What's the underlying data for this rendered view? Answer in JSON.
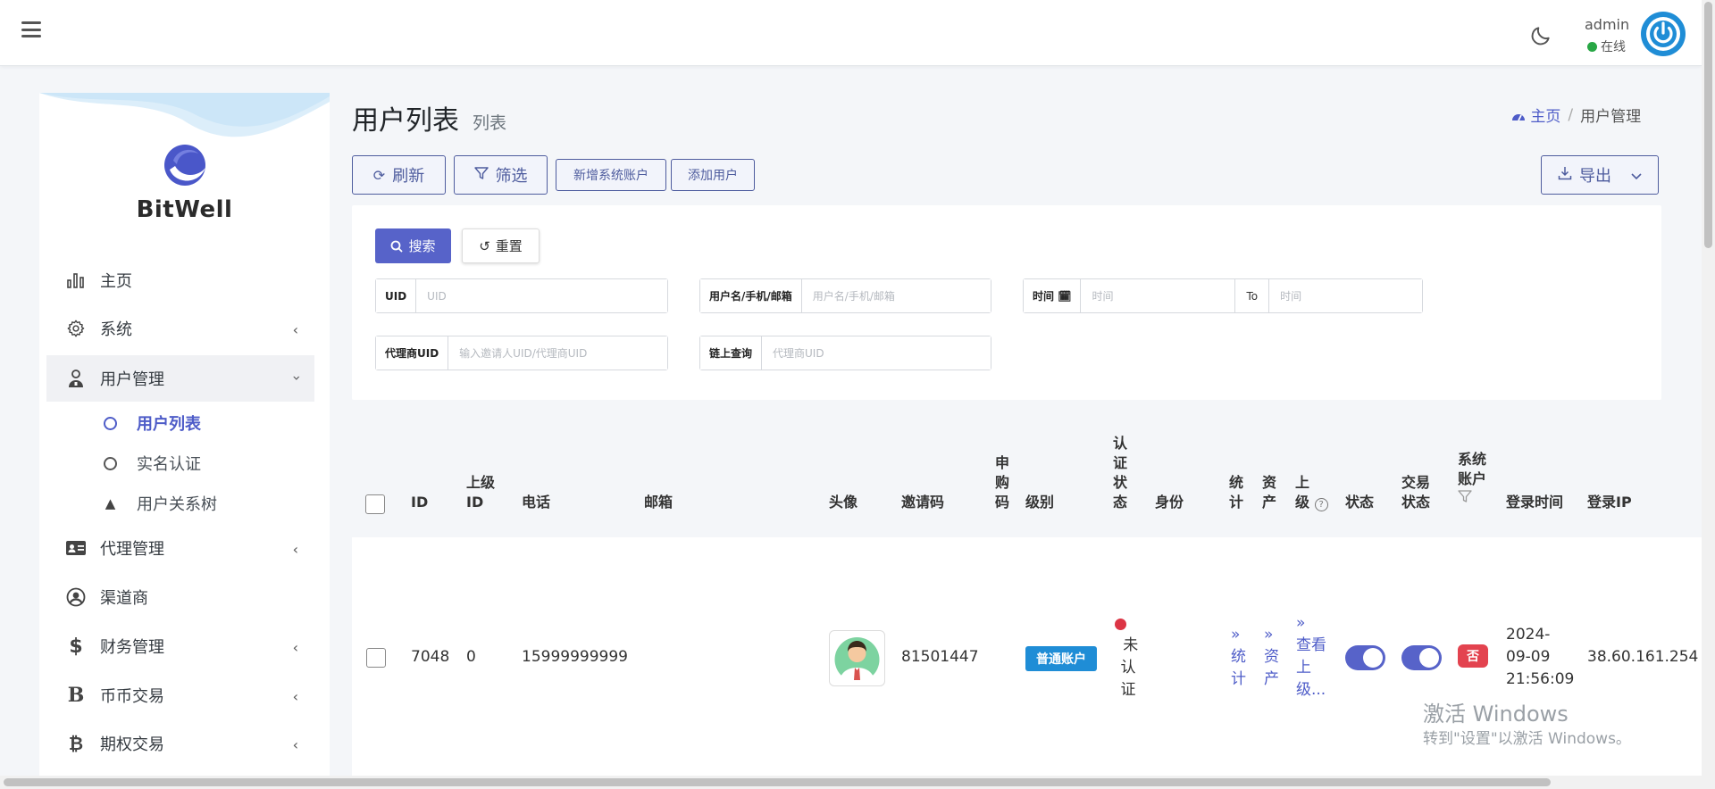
{
  "header": {
    "user_name": "admin",
    "user_status": "在线"
  },
  "sidebar": {
    "brand": "BitWell",
    "items": [
      {
        "label": "主页"
      },
      {
        "label": "系统"
      },
      {
        "label": "用户管理"
      },
      {
        "label": "代理管理"
      },
      {
        "label": "渠道商"
      },
      {
        "label": "财务管理"
      },
      {
        "label": "币币交易"
      },
      {
        "label": "期权交易"
      }
    ],
    "sub_items": [
      {
        "label": "用户列表"
      },
      {
        "label": "实名认证"
      },
      {
        "label": "用户关系树"
      }
    ]
  },
  "page": {
    "title": "用户列表",
    "subtitle": "列表",
    "breadcrumb_home": "主页",
    "breadcrumb_sep": "/",
    "breadcrumb_current": "用户管理"
  },
  "toolbar": {
    "refresh": "刷新",
    "filter": "筛选",
    "add_system_account": "新增系统账户",
    "add_user": "添加用户",
    "export": "导出"
  },
  "search": {
    "search_btn": "搜索",
    "reset_btn": "重置",
    "uid_label": "UID",
    "uid_placeholder": "UID",
    "username_label": "用户名/手机/邮箱",
    "username_placeholder": "用户名/手机/邮箱",
    "time_label": "时间",
    "time_placeholder": "时间",
    "to_label": "To",
    "time_end_placeholder": "时间",
    "agent_label": "代理商UID",
    "agent_placeholder": "输入邀请人UID/代理商UID",
    "chain_label": "链上查询",
    "chain_placeholder": "代理商UID"
  },
  "table": {
    "headers": {
      "id": "ID",
      "parent_id_1": "上级",
      "parent_id_2": "ID",
      "phone": "电话",
      "email": "邮箱",
      "avatar": "头像",
      "invite": "邀请码",
      "subscribe_1": "申",
      "subscribe_2": "购",
      "subscribe_3": "码",
      "level": "级别",
      "auth_1": "认",
      "auth_2": "证",
      "auth_3": "状",
      "auth_4": "态",
      "identity": "身份",
      "stats_1": "统",
      "stats_2": "计",
      "assets_1": "资",
      "assets_2": "产",
      "parent_1": "上",
      "parent_2": "级",
      "status": "状态",
      "trade_1": "交易",
      "trade_2": "状态",
      "sys_1": "系统",
      "sys_2": "账户",
      "login_time": "登录时间",
      "login_ip": "登录IP"
    },
    "row": {
      "id": "7048",
      "parent_id": "0",
      "phone": "15999999999",
      "invite": "81501447",
      "level": "普通账户",
      "auth_1": "未",
      "auth_2": "认",
      "auth_3": "证",
      "stats_1": "» ",
      "stats_2": "统",
      "stats_3": "计",
      "assets_1": "» ",
      "assets_2": "资",
      "assets_3": "产",
      "parent_1": "»",
      "parent_2": "查看",
      "parent_3": "上",
      "parent_4": "级...",
      "status_on": true,
      "trade_on": true,
      "system_account": "否",
      "login_date": "2024-",
      "login_date2": "09-09",
      "login_clock": "21:56:09",
      "login_ip": "38.60.161.254"
    }
  },
  "watermark": {
    "line1": "激活 Windows",
    "line2": "转到\"设置\"以激活 Windows。"
  }
}
